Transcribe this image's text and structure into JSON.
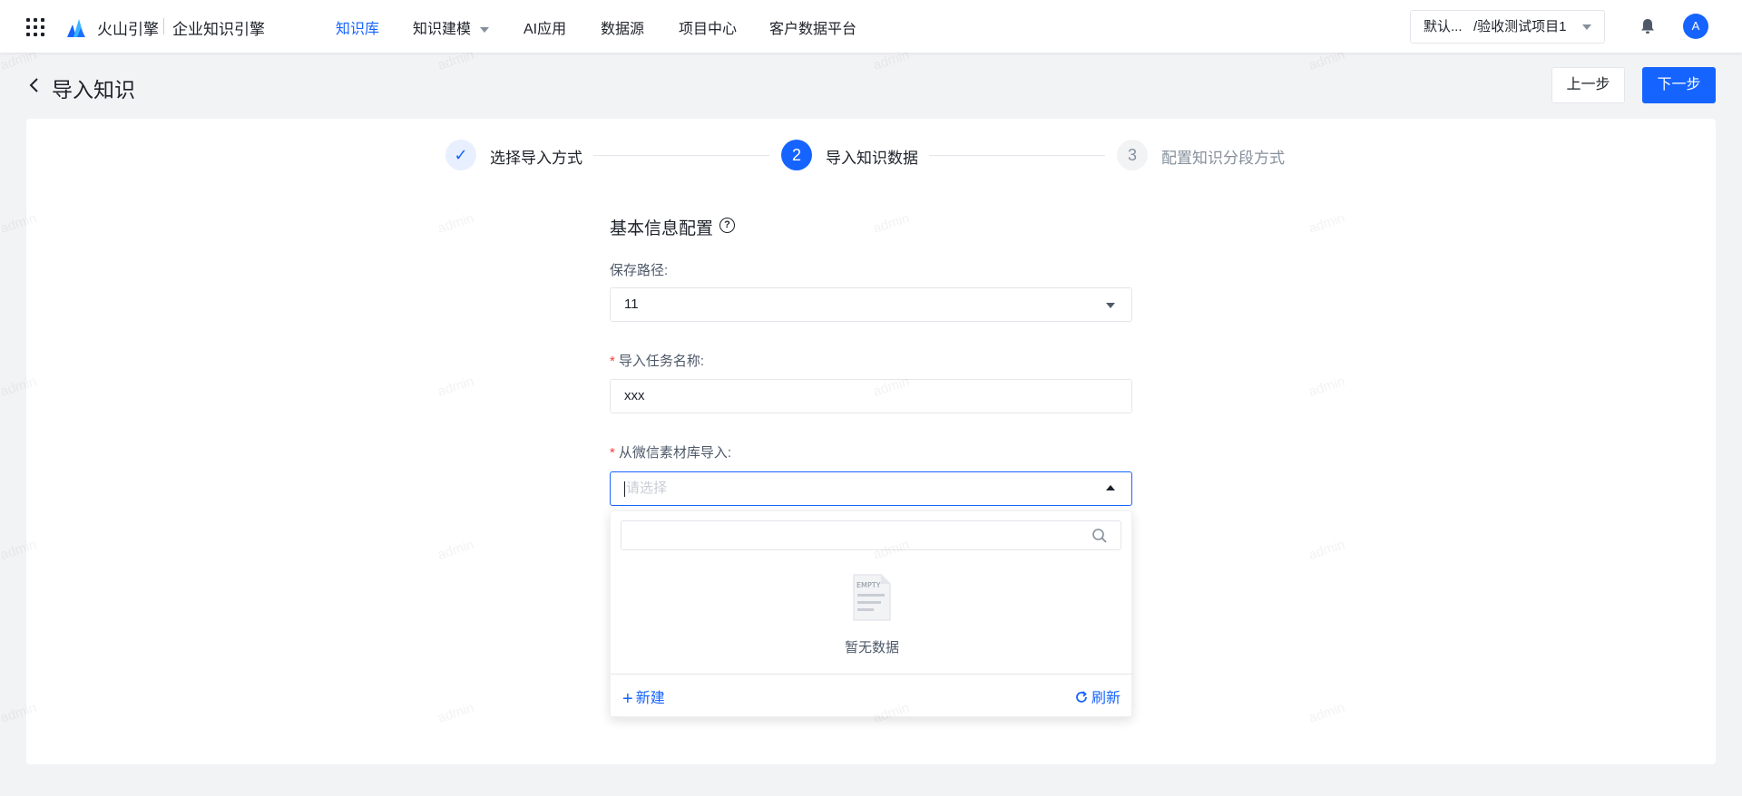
{
  "topbar": {
    "brand": "火山引擎",
    "product": "企业知识引擎",
    "nav": [
      "知识库",
      "知识建模",
      "AI应用",
      "数据源",
      "项目中心",
      "客户数据平台"
    ],
    "project_select": "默认...   /验收测试项目1",
    "avatar": "A"
  },
  "page": {
    "title": "导入知识",
    "prev_button": "上一步",
    "next_button": "下一步"
  },
  "steps": [
    {
      "number": "✓",
      "label": "选择导入方式",
      "status": "done"
    },
    {
      "number": "2",
      "label": "导入知识数据",
      "status": "active"
    },
    {
      "number": "3",
      "label": "配置知识分段方式",
      "status": "wait"
    }
  ],
  "form": {
    "section_title": "基本信息配置",
    "help": "?",
    "save_path_label": "保存路径:",
    "save_path_value": "11",
    "task_name_label": "导入任务名称:",
    "task_name_value": "xxx",
    "wechat_label": "从微信素材库导入:",
    "wechat_placeholder": "请选择",
    "required_mark": "*"
  },
  "dropdown": {
    "empty_text": "暂无数据",
    "empty_icon_text": "EMPTY",
    "new_label": "新建",
    "refresh_label": "刷新"
  },
  "watermark": "admin",
  "colors": {
    "primary": "#1664ff",
    "background": "#f2f3f5",
    "required": "#f53f3f"
  }
}
